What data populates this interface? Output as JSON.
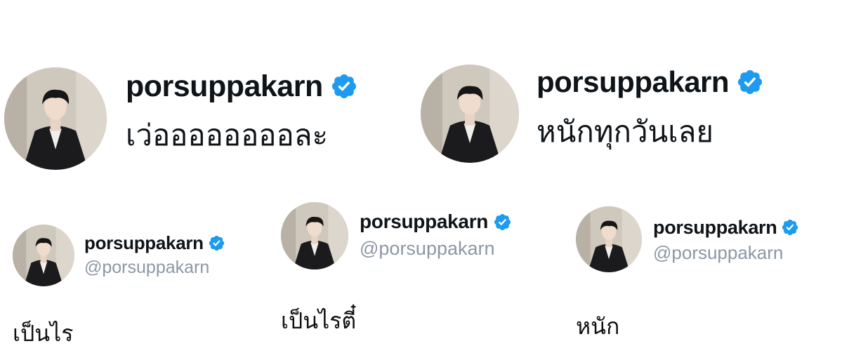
{
  "colors": {
    "verified_blue": "#1d9bf0",
    "handle_gray": "#8b98a5",
    "text": "#0f1419"
  },
  "icons": {
    "verified": "verified-badge-icon"
  },
  "posts_large": [
    {
      "username": "porsuppakarn",
      "text": "เว่ออออออออละ"
    },
    {
      "username": "porsuppakarn",
      "text": "หนักทุกวันเลย"
    }
  ],
  "profiles_small": [
    {
      "username": "porsuppakarn",
      "handle": "@porsuppakarn",
      "caption": "เป็นไร"
    },
    {
      "username": "porsuppakarn",
      "handle": "@porsuppakarn",
      "caption": "เป็นไรตี๋"
    },
    {
      "username": "porsuppakarn",
      "handle": "@porsuppakarn",
      "caption": "หนัก"
    }
  ]
}
